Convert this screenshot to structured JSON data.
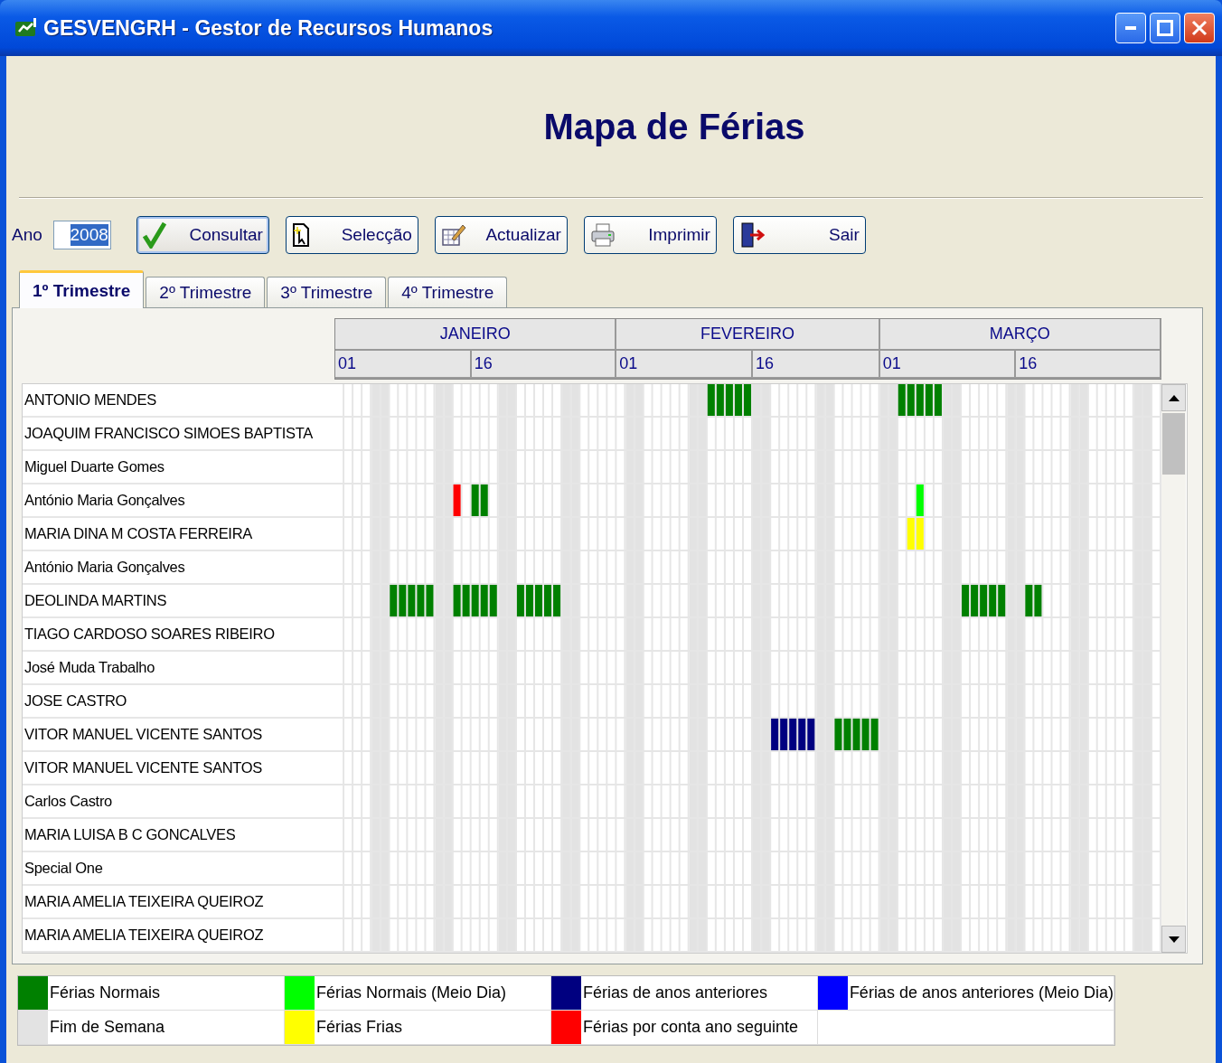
{
  "window": {
    "title": "GESVENGRH - Gestor de Recursos Humanos"
  },
  "heading": "Mapa de Férias",
  "toolbar": {
    "year_label": "Ano",
    "year_value": "2008",
    "buttons": [
      {
        "kind": "check",
        "label": "Consultar",
        "focused": true
      },
      {
        "kind": "select",
        "label": "Selecção",
        "focused": false
      },
      {
        "kind": "edit",
        "label": "Actualizar",
        "focused": false
      },
      {
        "kind": "print",
        "label": "Imprimir",
        "focused": false
      },
      {
        "kind": "exit",
        "label": "Sair",
        "focused": false
      }
    ]
  },
  "tabs": [
    {
      "label": "1º Trimestre",
      "selected": true
    },
    {
      "label": "2º Trimestre",
      "selected": false
    },
    {
      "label": "3º Trimestre",
      "selected": false
    },
    {
      "label": "4º Trimestre",
      "selected": false
    }
  ],
  "calendar": {
    "months": [
      {
        "name": "JANEIRO",
        "day_labels": [
          "01",
          "16"
        ]
      },
      {
        "name": "FEVEREIRO",
        "day_labels": [
          "01",
          "16"
        ]
      },
      {
        "name": "MARÇO",
        "day_labels": [
          "01",
          "16"
        ]
      }
    ],
    "rows": [
      {
        "name": "ANTONIO MENDES",
        "days": [
          {
            "kind": "none"
          },
          {
            "kind": "none"
          },
          {
            "kind": "none"
          },
          {
            "kind": "none"
          },
          {
            "kind": "none"
          },
          {
            "kind": "none"
          },
          {
            "kind": "none"
          },
          {
            "kind": "none"
          },
          {
            "kind": "none"
          },
          {
            "kind": "none"
          },
          {
            "kind": "none"
          },
          {
            "kind": "none"
          },
          {
            "kind": "none"
          },
          {
            "kind": "none"
          },
          {
            "kind": "none"
          },
          {
            "kind": "none"
          },
          {
            "kind": "none"
          },
          {
            "kind": "none"
          },
          {
            "kind": "none"
          },
          {
            "kind": "none"
          },
          {
            "kind": "none"
          },
          {
            "kind": "none"
          },
          {
            "kind": "none"
          },
          {
            "kind": "none"
          },
          {
            "kind": "none"
          },
          {
            "kind": "none"
          },
          {
            "kind": "none"
          },
          {
            "kind": "none"
          },
          {
            "kind": "none"
          },
          {
            "kind": "none"
          },
          {
            "kind": "none"
          },
          {
            "kind": "none"
          },
          {
            "kind": "none"
          },
          {
            "kind": "none"
          },
          {
            "kind": "none"
          },
          {
            "kind": "none"
          },
          {
            "kind": "none"
          },
          {
            "kind": "none"
          },
          {
            "kind": "none"
          },
          {
            "kind": "none"
          },
          {
            "kind": "none"
          },
          {
            "kind": "normal"
          },
          {
            "kind": "normal"
          },
          {
            "kind": "normal"
          },
          {
            "kind": "normal"
          },
          {
            "kind": "normal"
          },
          {
            "kind": "none"
          },
          {
            "kind": "none"
          },
          {
            "kind": "none"
          },
          {
            "kind": "none"
          },
          {
            "kind": "none"
          },
          {
            "kind": "none"
          },
          {
            "kind": "none"
          },
          {
            "kind": "none"
          },
          {
            "kind": "none"
          },
          {
            "kind": "none"
          },
          {
            "kind": "none"
          },
          {
            "kind": "none"
          },
          {
            "kind": "none"
          },
          {
            "kind": "none"
          },
          {
            "kind": "none"
          },
          {
            "kind": "none"
          },
          {
            "kind": "normal"
          },
          {
            "kind": "normal"
          },
          {
            "kind": "normal"
          },
          {
            "kind": "normal"
          },
          {
            "kind": "normal"
          }
        ]
      },
      {
        "name": "JOAQUIM FRANCISCO SIMOES BAPTISTA"
      },
      {
        "name": "Miguel Duarte Gomes"
      },
      {
        "name": "António Maria Gonçalves",
        "days": [
          {
            "kind": "none"
          },
          {
            "kind": "none"
          },
          {
            "kind": "none"
          },
          {
            "kind": "none"
          },
          {
            "kind": "none"
          },
          {
            "kind": "none"
          },
          {
            "kind": "none"
          },
          {
            "kind": "none"
          },
          {
            "kind": "none"
          },
          {
            "kind": "none"
          },
          {
            "kind": "none"
          },
          {
            "kind": "none"
          },
          {
            "kind": "none"
          },
          {
            "kind": "next_year"
          },
          {
            "kind": "none"
          },
          {
            "kind": "normal"
          },
          {
            "kind": "normal"
          },
          {
            "kind": "none"
          },
          {
            "kind": "none"
          },
          {
            "kind": "none"
          },
          {
            "kind": "none"
          },
          {
            "kind": "none"
          },
          {
            "kind": "none"
          },
          {
            "kind": "none"
          },
          {
            "kind": "none"
          },
          {
            "kind": "none"
          },
          {
            "kind": "none"
          },
          {
            "kind": "none"
          },
          {
            "kind": "none"
          },
          {
            "kind": "none"
          },
          {
            "kind": "none"
          },
          {
            "kind": "none"
          },
          {
            "kind": "none"
          },
          {
            "kind": "none"
          },
          {
            "kind": "none"
          },
          {
            "kind": "none"
          },
          {
            "kind": "none"
          },
          {
            "kind": "none"
          },
          {
            "kind": "none"
          },
          {
            "kind": "none"
          },
          {
            "kind": "none"
          },
          {
            "kind": "none"
          },
          {
            "kind": "none"
          },
          {
            "kind": "none"
          },
          {
            "kind": "none"
          },
          {
            "kind": "none"
          },
          {
            "kind": "none"
          },
          {
            "kind": "none"
          },
          {
            "kind": "none"
          },
          {
            "kind": "none"
          },
          {
            "kind": "none"
          },
          {
            "kind": "none"
          },
          {
            "kind": "none"
          },
          {
            "kind": "none"
          },
          {
            "kind": "none"
          },
          {
            "kind": "none"
          },
          {
            "kind": "none"
          },
          {
            "kind": "none"
          },
          {
            "kind": "none"
          },
          {
            "kind": "none"
          },
          {
            "kind": "none"
          },
          {
            "kind": "none"
          },
          {
            "kind": "none"
          },
          {
            "kind": "none"
          },
          {
            "kind": "normal_half"
          }
        ]
      },
      {
        "name": "MARIA DINA  M COSTA FERREIRA",
        "days": [
          {
            "kind": "none"
          },
          {
            "kind": "none"
          },
          {
            "kind": "none"
          },
          {
            "kind": "none"
          },
          {
            "kind": "none"
          },
          {
            "kind": "none"
          },
          {
            "kind": "none"
          },
          {
            "kind": "none"
          },
          {
            "kind": "none"
          },
          {
            "kind": "none"
          },
          {
            "kind": "none"
          },
          {
            "kind": "none"
          },
          {
            "kind": "none"
          },
          {
            "kind": "none"
          },
          {
            "kind": "none"
          },
          {
            "kind": "none"
          },
          {
            "kind": "none"
          },
          {
            "kind": "none"
          },
          {
            "kind": "none"
          },
          {
            "kind": "none"
          },
          {
            "kind": "none"
          },
          {
            "kind": "none"
          },
          {
            "kind": "none"
          },
          {
            "kind": "none"
          },
          {
            "kind": "none"
          },
          {
            "kind": "none"
          },
          {
            "kind": "none"
          },
          {
            "kind": "none"
          },
          {
            "kind": "none"
          },
          {
            "kind": "none"
          },
          {
            "kind": "none"
          },
          {
            "kind": "none"
          },
          {
            "kind": "none"
          },
          {
            "kind": "none"
          },
          {
            "kind": "none"
          },
          {
            "kind": "none"
          },
          {
            "kind": "none"
          },
          {
            "kind": "none"
          },
          {
            "kind": "none"
          },
          {
            "kind": "none"
          },
          {
            "kind": "none"
          },
          {
            "kind": "none"
          },
          {
            "kind": "none"
          },
          {
            "kind": "none"
          },
          {
            "kind": "none"
          },
          {
            "kind": "none"
          },
          {
            "kind": "none"
          },
          {
            "kind": "none"
          },
          {
            "kind": "none"
          },
          {
            "kind": "none"
          },
          {
            "kind": "none"
          },
          {
            "kind": "none"
          },
          {
            "kind": "none"
          },
          {
            "kind": "none"
          },
          {
            "kind": "none"
          },
          {
            "kind": "none"
          },
          {
            "kind": "none"
          },
          {
            "kind": "none"
          },
          {
            "kind": "none"
          },
          {
            "kind": "none"
          },
          {
            "kind": "none"
          },
          {
            "kind": "none"
          },
          {
            "kind": "none"
          },
          {
            "kind": "cold"
          },
          {
            "kind": "cold"
          }
        ]
      },
      {
        "name": "António Maria Gonçalves"
      },
      {
        "name": "DEOLINDA MARTINS",
        "days": [
          {
            "kind": "none"
          },
          {
            "kind": "none"
          },
          {
            "kind": "none"
          },
          {
            "kind": "none"
          },
          {
            "kind": "none"
          },
          {
            "kind": "none"
          },
          {
            "kind": "normal"
          },
          {
            "kind": "normal"
          },
          {
            "kind": "normal"
          },
          {
            "kind": "normal"
          },
          {
            "kind": "normal"
          },
          {
            "kind": "none"
          },
          {
            "kind": "none"
          },
          {
            "kind": "normal"
          },
          {
            "kind": "normal"
          },
          {
            "kind": "normal"
          },
          {
            "kind": "normal"
          },
          {
            "kind": "normal"
          },
          {
            "kind": "none"
          },
          {
            "kind": "none"
          },
          {
            "kind": "normal"
          },
          {
            "kind": "normal"
          },
          {
            "kind": "normal"
          },
          {
            "kind": "normal"
          },
          {
            "kind": "normal"
          },
          {
            "kind": "none"
          },
          {
            "kind": "none"
          },
          {
            "kind": "none"
          },
          {
            "kind": "none"
          },
          {
            "kind": "none"
          },
          {
            "kind": "none"
          },
          {
            "kind": "none"
          },
          {
            "kind": "none"
          },
          {
            "kind": "none"
          },
          {
            "kind": "none"
          },
          {
            "kind": "none"
          },
          {
            "kind": "none"
          },
          {
            "kind": "none"
          },
          {
            "kind": "none"
          },
          {
            "kind": "none"
          },
          {
            "kind": "none"
          },
          {
            "kind": "none"
          },
          {
            "kind": "none"
          },
          {
            "kind": "none"
          },
          {
            "kind": "none"
          },
          {
            "kind": "none"
          },
          {
            "kind": "none"
          },
          {
            "kind": "none"
          },
          {
            "kind": "none"
          },
          {
            "kind": "none"
          },
          {
            "kind": "none"
          },
          {
            "kind": "none"
          },
          {
            "kind": "none"
          },
          {
            "kind": "none"
          },
          {
            "kind": "none"
          },
          {
            "kind": "none"
          },
          {
            "kind": "none"
          },
          {
            "kind": "none"
          },
          {
            "kind": "none"
          },
          {
            "kind": "none"
          },
          {
            "kind": "none"
          },
          {
            "kind": "none"
          },
          {
            "kind": "none"
          },
          {
            "kind": "none"
          },
          {
            "kind": "none"
          },
          {
            "kind": "none"
          },
          {
            "kind": "none"
          },
          {
            "kind": "none"
          },
          {
            "kind": "none"
          },
          {
            "kind": "normal"
          },
          {
            "kind": "normal"
          },
          {
            "kind": "normal"
          },
          {
            "kind": "normal"
          },
          {
            "kind": "normal"
          },
          {
            "kind": "none"
          },
          {
            "kind": "none"
          },
          {
            "kind": "normal"
          },
          {
            "kind": "normal"
          }
        ]
      },
      {
        "name": "TIAGO CARDOSO SOARES RIBEIRO"
      },
      {
        "name": "José Muda Trabalho"
      },
      {
        "name": "JOSE CASTRO"
      },
      {
        "name": "VITOR MANUEL VICENTE SANTOS",
        "days": [
          {
            "kind": "none"
          },
          {
            "kind": "none"
          },
          {
            "kind": "none"
          },
          {
            "kind": "none"
          },
          {
            "kind": "none"
          },
          {
            "kind": "none"
          },
          {
            "kind": "none"
          },
          {
            "kind": "none"
          },
          {
            "kind": "none"
          },
          {
            "kind": "none"
          },
          {
            "kind": "none"
          },
          {
            "kind": "none"
          },
          {
            "kind": "none"
          },
          {
            "kind": "none"
          },
          {
            "kind": "none"
          },
          {
            "kind": "none"
          },
          {
            "kind": "none"
          },
          {
            "kind": "none"
          },
          {
            "kind": "none"
          },
          {
            "kind": "none"
          },
          {
            "kind": "none"
          },
          {
            "kind": "none"
          },
          {
            "kind": "none"
          },
          {
            "kind": "none"
          },
          {
            "kind": "none"
          },
          {
            "kind": "none"
          },
          {
            "kind": "none"
          },
          {
            "kind": "none"
          },
          {
            "kind": "none"
          },
          {
            "kind": "none"
          },
          {
            "kind": "none"
          },
          {
            "kind": "none"
          },
          {
            "kind": "none"
          },
          {
            "kind": "none"
          },
          {
            "kind": "none"
          },
          {
            "kind": "none"
          },
          {
            "kind": "none"
          },
          {
            "kind": "none"
          },
          {
            "kind": "none"
          },
          {
            "kind": "none"
          },
          {
            "kind": "none"
          },
          {
            "kind": "none"
          },
          {
            "kind": "none"
          },
          {
            "kind": "none"
          },
          {
            "kind": "none"
          },
          {
            "kind": "none"
          },
          {
            "kind": "none"
          },
          {
            "kind": "none"
          },
          {
            "kind": "previous"
          },
          {
            "kind": "previous"
          },
          {
            "kind": "previous"
          },
          {
            "kind": "previous"
          },
          {
            "kind": "previous"
          },
          {
            "kind": "none"
          },
          {
            "kind": "none"
          },
          {
            "kind": "normal"
          },
          {
            "kind": "normal"
          },
          {
            "kind": "normal"
          },
          {
            "kind": "normal"
          },
          {
            "kind": "normal"
          }
        ]
      },
      {
        "name": "VITOR MANUEL VICENTE SANTOS"
      },
      {
        "name": "Carlos Castro"
      },
      {
        "name": "MARIA LUISA B C GONCALVES"
      },
      {
        "name": "Special One"
      },
      {
        "name": "MARIA AMELIA TEIXEIRA  QUEIROZ"
      },
      {
        "name": "MARIA AMELIA TEIXEIRA  QUEIROZ"
      }
    ]
  },
  "legend": [
    {
      "kind": "normal",
      "label": "Férias Normais",
      "color": "#008000"
    },
    {
      "kind": "normal_half",
      "label": "Férias Normais (Meio Dia)",
      "color": "#00ff00"
    },
    {
      "kind": "previous",
      "label": "Férias de anos anteriores",
      "color": "#000080"
    },
    {
      "kind": "previous_half",
      "label": "Férias de anos anteriores (Meio Dia)",
      "color": "#0000ff"
    },
    {
      "kind": "weekend",
      "label": "Fim de Semana",
      "color": "#e3e3e3"
    },
    {
      "kind": "cold",
      "label": "Férias Frias",
      "color": "#ffff00"
    },
    {
      "kind": "next_year",
      "label": "Férias por conta ano seguinte",
      "color": "#ff0000"
    }
  ]
}
